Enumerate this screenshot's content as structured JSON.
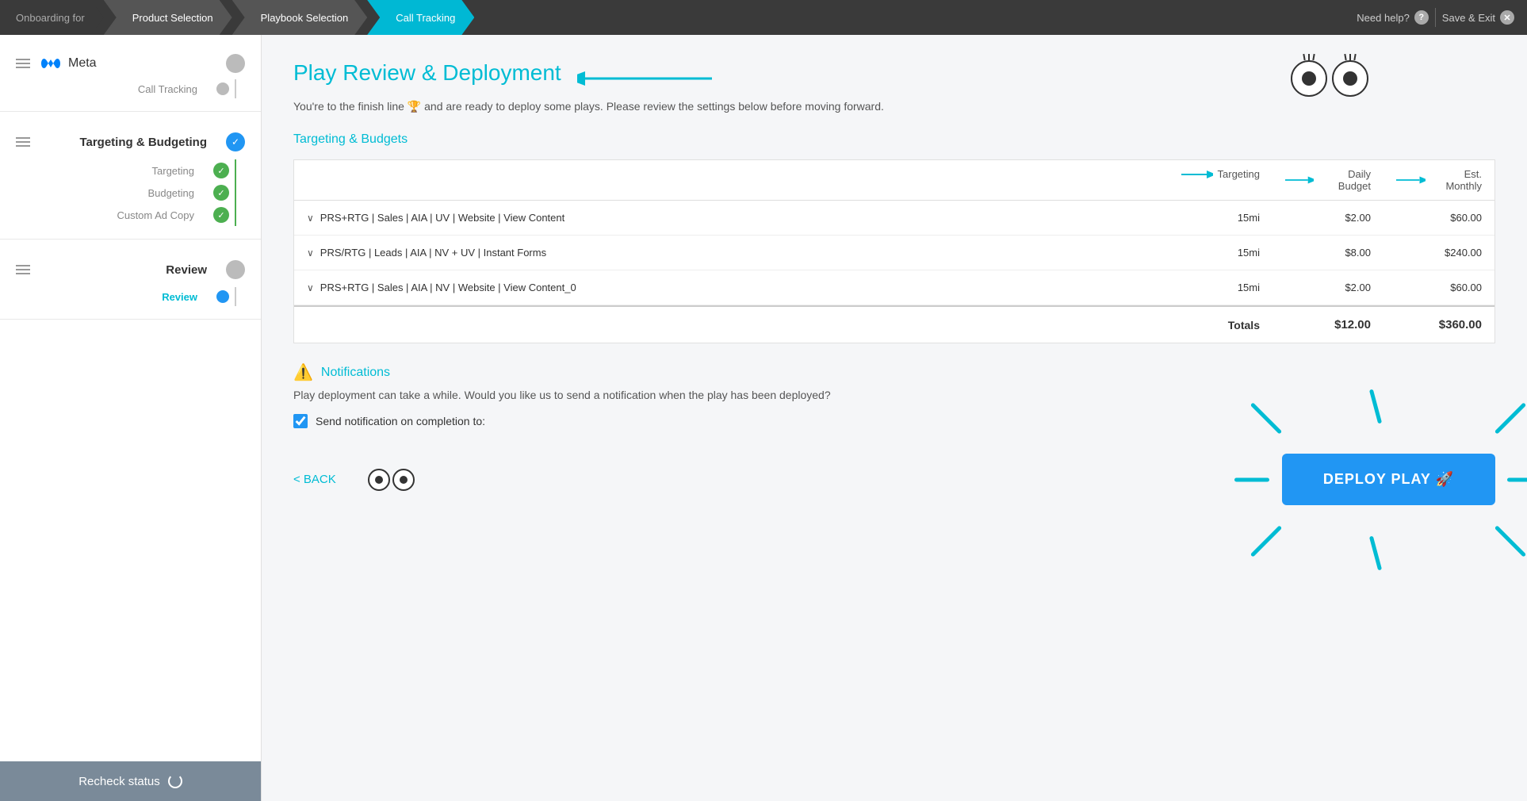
{
  "topNav": {
    "steps": [
      {
        "id": "onboarding",
        "label": "Onboarding for",
        "state": "done"
      },
      {
        "id": "product-selection",
        "label": "Product Selection",
        "state": "done"
      },
      {
        "id": "playbook-selection",
        "label": "Playbook Selection",
        "state": "done"
      },
      {
        "id": "call-tracking",
        "label": "Call Tracking",
        "state": "current"
      }
    ],
    "need_help_label": "Need help?",
    "save_exit_label": "Save & Exit"
  },
  "sidebar": {
    "meta_label": "Meta",
    "call_tracking_label": "Call Tracking",
    "targeting_budgeting_label": "Targeting & Budgeting",
    "targeting_label": "Targeting",
    "budgeting_label": "Budgeting",
    "custom_ad_copy_label": "Custom Ad Copy",
    "review_label": "Review",
    "review_sub_label": "Review",
    "recheck_label": "Recheck status"
  },
  "main": {
    "title": "Play Review & Deployment",
    "subtitle": "You're to the finish line 🏆 and are ready to deploy some plays. Please review the settings below before moving forward.",
    "targeting_section_title": "Targeting & Budgets",
    "col_targeting": "Targeting",
    "col_daily_budget": "Daily Budget",
    "col_est_monthly": "Est. Monthly",
    "rows": [
      {
        "name": "PRS+RTG | Sales | AIA | UV | Website | View Content",
        "targeting": "15mi",
        "daily_budget": "$2.00",
        "est_monthly": "$60.00"
      },
      {
        "name": "PRS/RTG | Leads | AIA | NV + UV | Instant Forms",
        "targeting": "15mi",
        "daily_budget": "$8.00",
        "est_monthly": "$240.00"
      },
      {
        "name": "PRS+RTG | Sales | AIA | NV | Website | View Content_0",
        "targeting": "15mi",
        "daily_budget": "$2.00",
        "est_monthly": "$60.00"
      }
    ],
    "totals_label": "Totals",
    "totals_daily": "$12.00",
    "totals_monthly": "$360.00",
    "notifications_title": "Notifications",
    "notifications_text": "Play deployment can take a while. Would you like us to send a notification when the play has been deployed?",
    "send_notification_label": "Send notification on completion to:",
    "back_label": "< BACK",
    "deploy_label": "DEPLOY PLAY 🚀"
  }
}
